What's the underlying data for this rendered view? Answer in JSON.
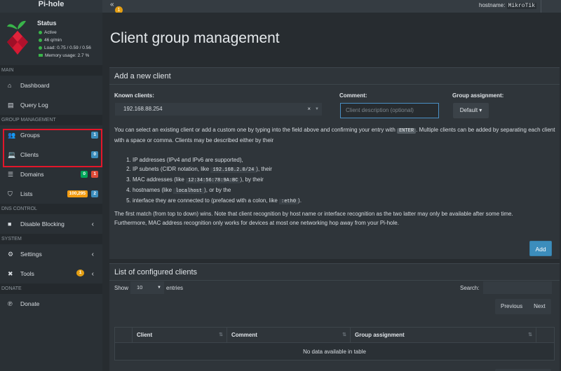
{
  "topbar": {
    "brand": "Pi-hole",
    "toggle_icon": "«",
    "toggle_badge": "1",
    "hostname_label": "hostname:",
    "hostname_value": "MikroTik"
  },
  "sidebar": {
    "status": {
      "title": "Status",
      "active": "Active",
      "queries": "46 q/min",
      "load": "Load:  0.75  /  0.59  /  0.56",
      "memory": "Memory usage:  2.7 %"
    },
    "sections": {
      "main": "MAIN",
      "group": "GROUP MANAGEMENT",
      "dns": "DNS CONTROL",
      "system": "SYSTEM",
      "donate": "DONATE"
    },
    "items": {
      "dashboard": "Dashboard",
      "querylog": "Query Log",
      "groups": "Groups",
      "groups_badge": "1",
      "clients": "Clients",
      "clients_badge": "0",
      "domains": "Domains",
      "domains_badge_green": "0",
      "domains_badge_red": "1",
      "lists": "Lists",
      "lists_badge_yellow": "100,295",
      "lists_badge_blue": "2",
      "disable": "Disable Blocking",
      "settings": "Settings",
      "tools": "Tools",
      "tools_badge": "1",
      "donate": "Donate"
    }
  },
  "main": {
    "page_title": "Client group management",
    "add_box": {
      "title": "Add a new client",
      "known_label": "Known clients:",
      "known_value": "192.168.88.254",
      "clear_icon": "×",
      "comment_label": "Comment:",
      "comment_placeholder": "Client description (optional)",
      "group_label": "Group assignment:",
      "group_value": "Default",
      "help_p1a": "You can select an existing client or add a custom one by typing into the field above and confirming your entry with",
      "help_kbd": "ENTER",
      "help_p1b": ". Multiple clients can be added by separating",
      "help_p1c": "each client with a space or comma. Clients may be described either by their",
      "list": {
        "i1": "IP addresses (IPv4 and IPv6 are supported),",
        "i2a": "IP subnets (CIDR notation, like",
        "i2code": "192.168.2.0/24",
        "i2b": "), their",
        "i3a": "MAC addresses (like",
        "i3code": "12:34:56:78:9A:BC",
        "i3b": "), by their",
        "i4a": "hostnames (like",
        "i4code": "localhost",
        "i4b": "), or by the",
        "i5a": "interface they are connected to (prefaced with a colon, like",
        "i5code": ":eth0",
        "i5b": ")."
      },
      "help_p2a": "The first match (from top to down) wins. Note that client recognition by host name or interface recognition as the two latter may only be available after some time.",
      "help_p2b": "Furthermore, MAC address recognition only works for devices at most one networking hop away from your Pi-hole.",
      "add_button": "Add"
    },
    "list_box": {
      "title": "List of configured clients",
      "show_label": "Show",
      "show_value": "10",
      "entries_label": "entries",
      "search_label": "Search:",
      "previous": "Previous",
      "next": "Next",
      "columns": [
        "Client",
        "Comment",
        "Group assignment"
      ],
      "empty_message": "No data available in table"
    }
  },
  "colors": {
    "accent": "#3c8dbc",
    "highlight": "#e3162a",
    "status_green": "#39b54a"
  }
}
